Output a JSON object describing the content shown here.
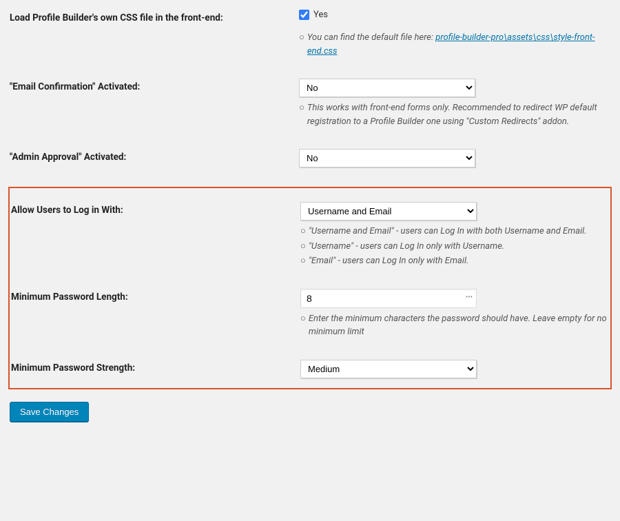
{
  "settings": {
    "load_css": {
      "label": "Load Profile Builder's own CSS file in the front-end:",
      "checkbox_label": "Yes",
      "checked": true,
      "desc_prefix": "You can find the default file here: ",
      "desc_link": "profile-builder-pro\\assets\\css\\style-front-end.css"
    },
    "email_confirmation": {
      "label": "\"Email Confirmation\" Activated:",
      "value": "No",
      "desc": "This works with front-end forms only. Recommended to redirect WP default registration to a Profile Builder one using \"Custom Redirects\" addon."
    },
    "admin_approval": {
      "label": "\"Admin Approval\" Activated:",
      "value": "No"
    },
    "login_with": {
      "label": "Allow Users to Log in With:",
      "value": "Username and Email",
      "desc1": "\"Username and Email\" - users can Log In with both Username and Email.",
      "desc2": "\"Username\" - users can Log In only with Username.",
      "desc3": "\"Email\" - users can Log In only with Email."
    },
    "min_pwd_length": {
      "label": "Minimum Password Length:",
      "value": "8",
      "desc": "Enter the minimum characters the password should have. Leave empty for no minimum limit"
    },
    "min_pwd_strength": {
      "label": "Minimum Password Strength:",
      "value": "Medium"
    }
  },
  "buttons": {
    "save": "Save Changes"
  }
}
